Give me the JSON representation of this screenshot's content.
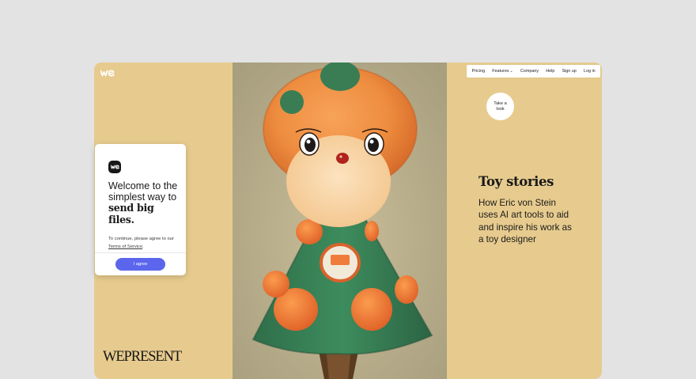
{
  "brand": {
    "logo_icon": "wetransfer-logo-icon"
  },
  "nav": {
    "items": [
      {
        "label": "Pricing"
      },
      {
        "label": "Features"
      },
      {
        "label": "Company"
      },
      {
        "label": "Help"
      },
      {
        "label": "Sign up"
      },
      {
        "label": "Log in"
      }
    ],
    "dropdown_icon": "chevron-down-icon"
  },
  "feature": {
    "cta_label": "Take a look",
    "title": "Toy stories",
    "description": "How Eric von Stein uses AI art tools to aid and inspire his work as a toy designer",
    "publication": "WEPRESENT"
  },
  "consent_modal": {
    "welcome_plain": "Welcome to the simplest way to ",
    "welcome_bold": "send big files.",
    "consent_text": "To continue, please agree to our ",
    "terms_link": "Terms of Service",
    "consent_end": ".",
    "agree_button": "I agree"
  },
  "colors": {
    "page_background": "#e3e3e4",
    "panel_background": "#e7cb8e",
    "agree_button": "#5b66ed"
  }
}
